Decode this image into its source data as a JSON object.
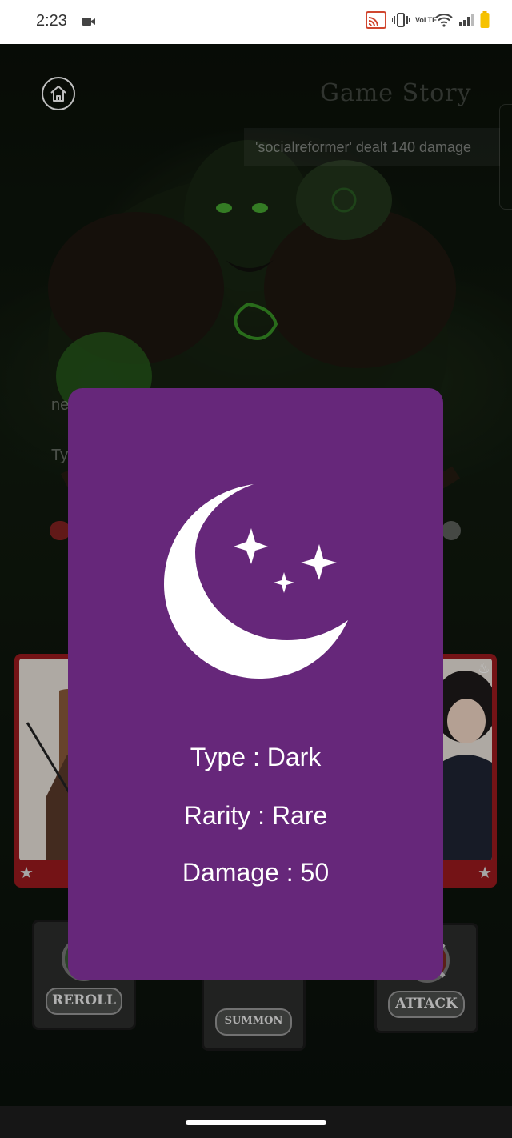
{
  "status_bar": {
    "time": "2:23",
    "icons": [
      "video-icon",
      "cast-icon",
      "vibrate-icon",
      "volte-icon",
      "wifi-icon",
      "signal-icon",
      "battery-icon"
    ],
    "volte_label": "VoLTE"
  },
  "header": {
    "home_icon": "home-icon",
    "title": "Game Story",
    "log_text": "'socialreformer' dealt 140 damage"
  },
  "background": {
    "chat_line_1": "ne",
    "chat_placeholder": "Ty"
  },
  "actions": {
    "reroll": "REROLL",
    "summon": "SUMMON",
    "attack": "ATTACK"
  },
  "card_detail": {
    "icon": "moon-stars-icon",
    "type": "Type : Dark",
    "rarity": "Rarity : Rare",
    "damage": "Damage : 50",
    "background_color": "#66277a"
  }
}
